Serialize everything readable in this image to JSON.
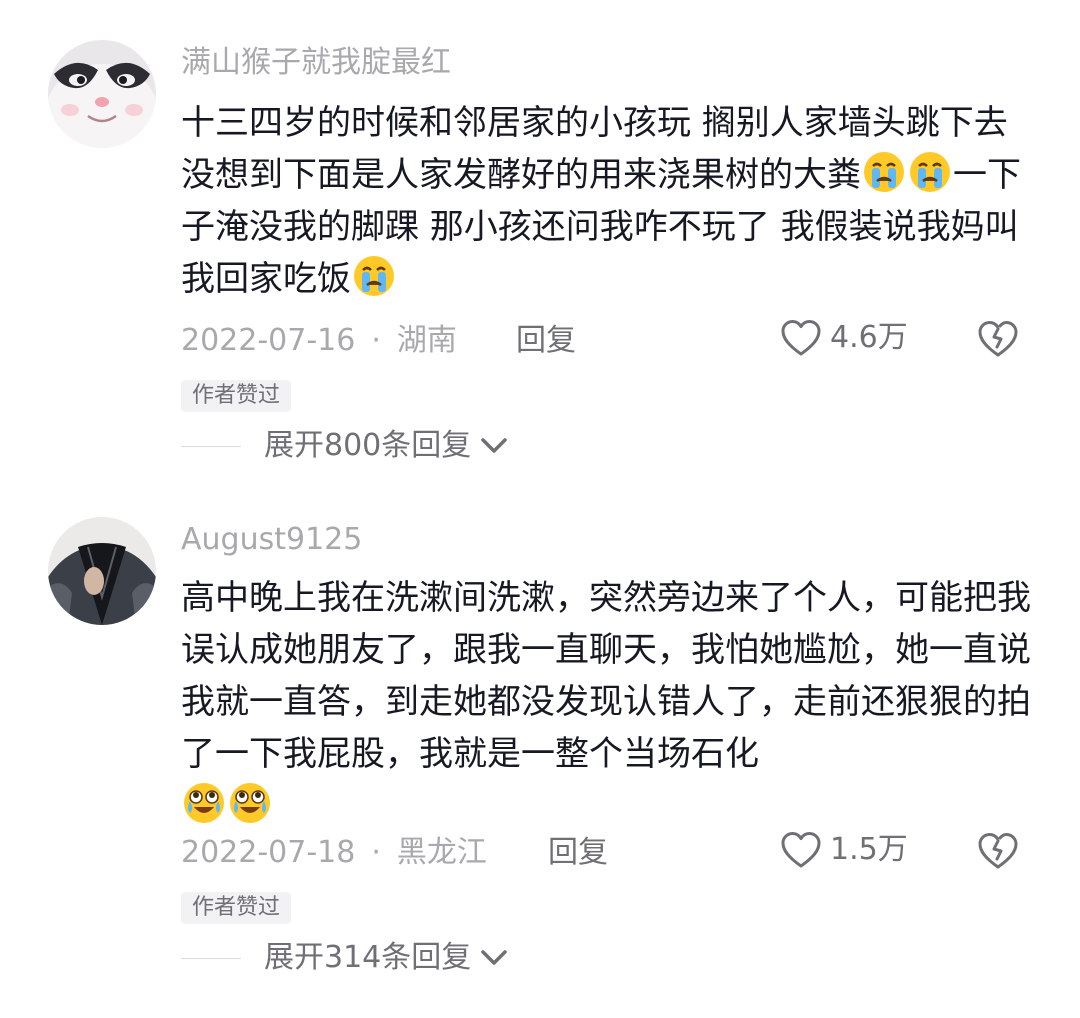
{
  "comments": [
    {
      "username": "满山猴子就我腚最红",
      "avatar_icon": "white-cat-avatar",
      "text_parts": [
        "十三四岁的时候和邻居家的小孩玩 搁别人家墙头跳下去 没想到下面是人家发酵好的用来浇果树的大粪",
        "一下子淹没我的脚踝 那小孩还问我咋不玩了 我假装说我妈叫我回家吃饭"
      ],
      "date": "2022-07-16",
      "separator": "·",
      "location": "湖南",
      "reply_label": "回复",
      "like_count": "4.6万",
      "badge": "作者赞过",
      "expand_label": "展开800条回复"
    },
    {
      "username": "August9125",
      "avatar_icon": "person-jacket-avatar",
      "text": "高中晚上我在洗漱间洗漱，突然旁边来了个人，可能把我误认成她朋友了，跟我一直聊天，我怕她尴尬，她一直说我就一直答，到走她都没发现认错人了，走前还狠狠的拍了一下我屁股，我就是一整个当场石化",
      "date": "2022-07-18",
      "separator": "·",
      "location": "黑龙江",
      "reply_label": "回复",
      "like_count": "1.5万",
      "badge": "作者赞过",
      "expand_label": "展开314条回复"
    }
  ],
  "colors": {
    "text": "#161823",
    "secondary": "#a8a9ad",
    "action": "#6e7075",
    "badge_bg": "#f2f2f4"
  }
}
